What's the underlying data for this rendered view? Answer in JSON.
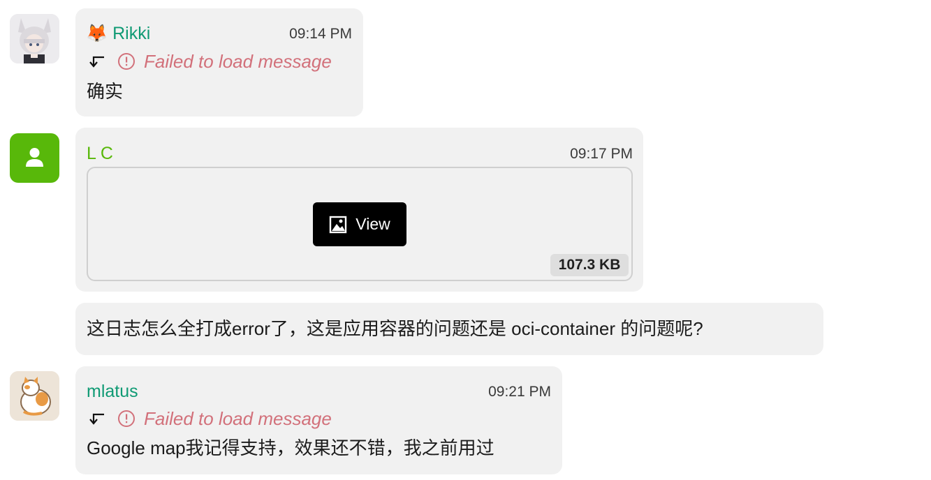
{
  "colors": {
    "rikki_name": "#0f9a74",
    "lc_name": "#58b80a",
    "lc_avatar_bg": "#58b80a",
    "mlatus_name": "#0f9a74",
    "error": "#d2707a",
    "bubble_bg": "#f1f1f1"
  },
  "messages": [
    {
      "sender": "Rikki",
      "sender_emoji": "🦊",
      "time": "09:14 PM",
      "reply_error": "Failed to load message",
      "text": "确实",
      "avatar_icon": "anime-girl-avatar"
    },
    {
      "sender": "L C",
      "time": "09:17 PM",
      "attachment": {
        "button_label": "View",
        "size": "107.3 KB",
        "icon": "image-icon"
      },
      "avatar_icon": "user-icon"
    },
    {
      "text": "这日志怎么全打成error了，这是应用容器的问题还是 oci-container  的问题呢?"
    },
    {
      "sender": "mlatus",
      "time": "09:21 PM",
      "reply_error": "Failed to load message",
      "text": "Google map我记得支持，效果还不错，我之前用过",
      "avatar_icon": "cat-avatar"
    }
  ]
}
